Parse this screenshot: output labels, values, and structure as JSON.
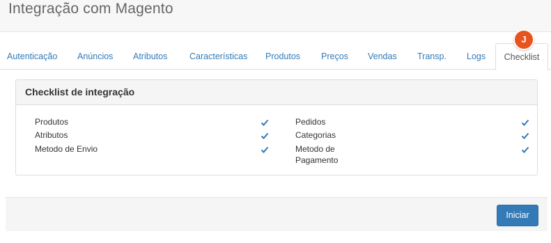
{
  "page": {
    "title": "Integração com Magento"
  },
  "tabs": [
    {
      "label": "Autenticação"
    },
    {
      "label": "Anúncios"
    },
    {
      "label": "Atributos"
    },
    {
      "label": "Características"
    },
    {
      "label": "Produtos"
    },
    {
      "label": "Preços"
    },
    {
      "label": "Vendas"
    },
    {
      "label": "Transp."
    },
    {
      "label": "Logs"
    },
    {
      "label": "Checklist",
      "active": true
    }
  ],
  "user_badge": {
    "initial": "J",
    "color": "#e8541f"
  },
  "checklist": {
    "title": "Checklist de integração",
    "left": [
      {
        "label": "Produtos",
        "checked": true
      },
      {
        "label": "Atributos",
        "checked": true
      },
      {
        "label": "Metodo de Envio",
        "checked": true
      }
    ],
    "right": [
      {
        "label": "Pedidos",
        "checked": true
      },
      {
        "label": "Categorias",
        "checked": true
      },
      {
        "label": "Metodo de Pagamento",
        "checked": true
      }
    ],
    "check_icon": "check-icon",
    "check_color": "#337ab7"
  },
  "footer": {
    "start_button": "Iniciar"
  },
  "colors": {
    "primary": "#337ab7",
    "badge": "#e8541f"
  }
}
